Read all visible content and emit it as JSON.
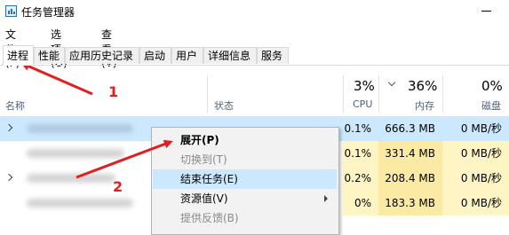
{
  "window": {
    "title": "任务管理器"
  },
  "menu": [
    "文件(F)",
    "选项(O)",
    "查看(V)"
  ],
  "tabs": [
    "进程",
    "性能",
    "应用历史记录",
    "启动",
    "用户",
    "详细信息",
    "服务"
  ],
  "columns": {
    "name": "名称",
    "status": "状态",
    "cpu": {
      "percent": "3%",
      "label": "CPU"
    },
    "memory": {
      "percent": "36%",
      "label": "内存"
    },
    "disk": {
      "percent": "0%",
      "label": "磁盘"
    }
  },
  "rows": [
    {
      "cpu": "0.1%",
      "memory": "666.3 MB",
      "disk": "0 MB/秒",
      "selected": true
    },
    {
      "cpu": "0.1%",
      "memory": "331.4 MB",
      "disk": "0 MB/秒"
    },
    {
      "cpu": "0.2%",
      "memory": "208.4 MB",
      "disk": "0 MB/秒"
    },
    {
      "cpu": "0%",
      "memory": "183.3 MB",
      "disk": "0 MB/秒"
    }
  ],
  "context_menu": {
    "items": [
      {
        "label": "展开(P)",
        "style": "bold"
      },
      {
        "label": "切换到(T)",
        "style": "disabled"
      },
      {
        "label": "结束任务(E)",
        "style": "highlighted"
      },
      {
        "label": "资源值(V)",
        "style": "submenu"
      },
      {
        "label": "提供反馈(B)",
        "style": "disabled"
      }
    ]
  },
  "annotations": [
    "1",
    "2"
  ],
  "colors": {
    "annotation": "#e02020",
    "selection": "#cce8ff",
    "heat_light": "#fff4c4",
    "heat_dark": "#fbeaa4"
  }
}
